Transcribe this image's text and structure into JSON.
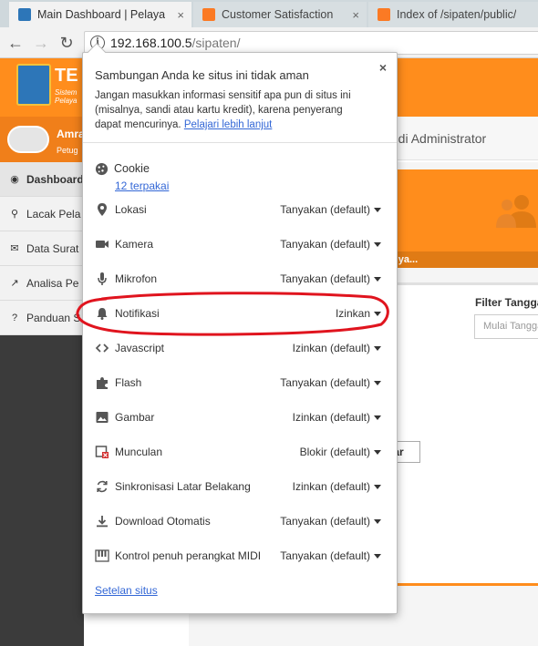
{
  "browser": {
    "tabs": [
      {
        "label": "Main Dashboard | Pelaya",
        "active": true
      },
      {
        "label": "Customer Satisfaction",
        "active": false
      },
      {
        "label": "Index of /sipaten/public/",
        "active": false
      }
    ],
    "close_glyph": "×",
    "url_host": "192.168.100.5",
    "url_path": "/sipaten/"
  },
  "page": {
    "brand": "TE",
    "brand_sub_line1": "Sistem",
    "brand_sub_line2": "Pelaya",
    "user_name": "Amra",
    "user_role": "Petug",
    "header_text": "g di Administrator",
    "sidebar_items": [
      {
        "label": "Dashboard",
        "icon": "dashboard-icon"
      },
      {
        "label": "Lacak Pela",
        "icon": "search-icon"
      },
      {
        "label": "Data Surat",
        "icon": "envelope-icon"
      },
      {
        "label": "Analisa Pe",
        "icon": "line-chart-icon"
      },
      {
        "label": "Panduan S",
        "icon": "question-circle-icon"
      }
    ],
    "card_more": "nya...",
    "filter_label": "Filter Tangga",
    "filter_placeholder": "Mulai Tangga",
    "keluar_button": "uar"
  },
  "popup": {
    "title": "Sambungan Anda ke situs ini tidak aman",
    "desc": "Jangan masukkan informasi sensitif apa pun di situs ini (misalnya, sandi atau kartu kredit), karena penyerang dapat mencurinya.",
    "learn_more": "Pelajari lebih lanjut",
    "cookie_label": "Cookie",
    "cookie_link": "12 terpakai",
    "permissions": [
      {
        "label": "Lokasi",
        "value": "Tanyakan (default)",
        "icon": "location-pin-icon"
      },
      {
        "label": "Kamera",
        "value": "Tanyakan (default)",
        "icon": "camera-icon"
      },
      {
        "label": "Mikrofon",
        "value": "Tanyakan (default)",
        "icon": "microphone-icon"
      },
      {
        "label": "Notifikasi",
        "value": "Izinkan",
        "icon": "bell-icon"
      },
      {
        "label": "Javascript",
        "value": "Izinkan (default)",
        "icon": "code-icon"
      },
      {
        "label": "Flash",
        "value": "Tanyakan (default)",
        "icon": "puzzle-icon"
      },
      {
        "label": "Gambar",
        "value": "Izinkan (default)",
        "icon": "image-icon"
      },
      {
        "label": "Munculan",
        "value": "Blokir (default)",
        "icon": "popup-blocked-icon"
      },
      {
        "label": "Sinkronisasi Latar Belakang",
        "value": "Izinkan (default)",
        "icon": "sync-icon"
      },
      {
        "label": "Download Otomatis",
        "value": "Tanyakan (default)",
        "icon": "download-icon"
      },
      {
        "label": "Kontrol penuh perangkat MIDI",
        "value": "Tanyakan (default)",
        "icon": "midi-piano-icon"
      }
    ],
    "site_settings": "Setelan situs"
  },
  "colors": {
    "accent_orange": "#ff8d1c",
    "link_blue": "#3367d6",
    "annotation_red": "#e0141e"
  }
}
